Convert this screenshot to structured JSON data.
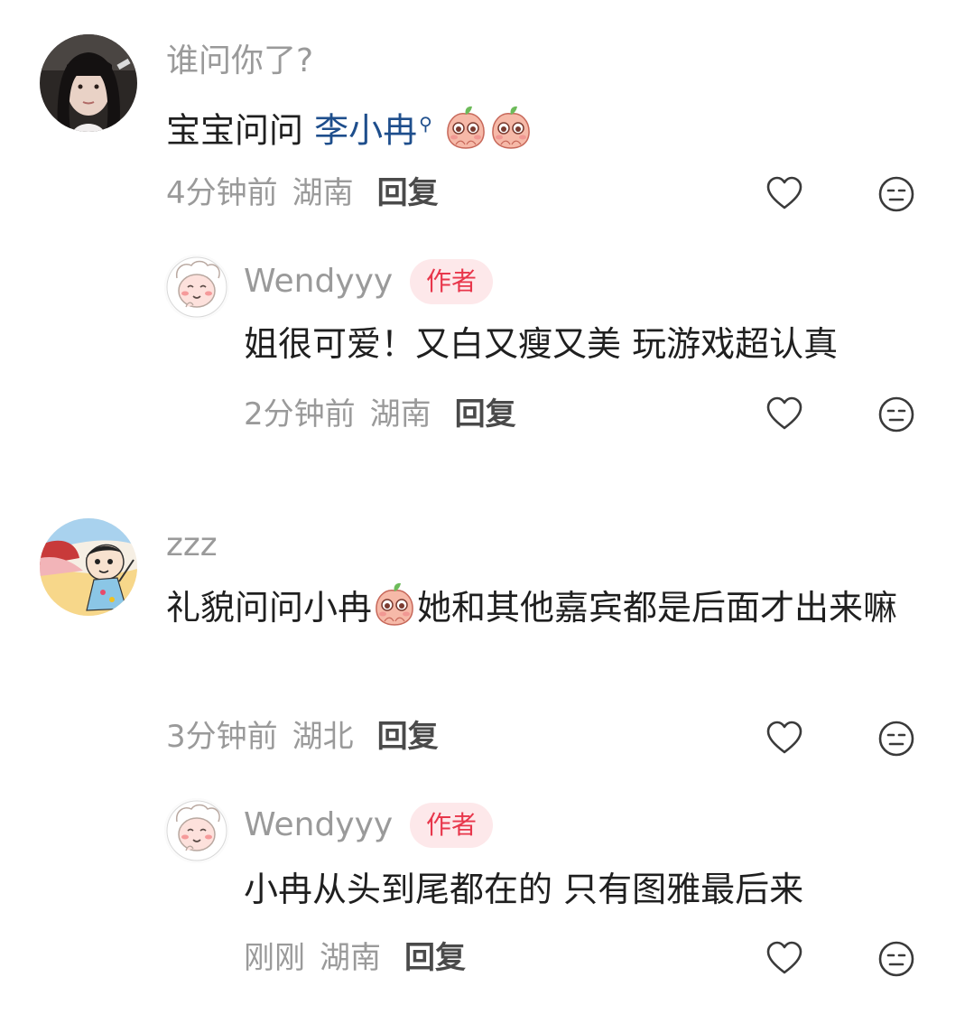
{
  "comments": [
    {
      "username": "谁问你了?",
      "content_prefix": "宝宝问问 ",
      "mention": "李小冉",
      "content_suffix": "",
      "time": "4分钟前",
      "location": "湖南",
      "reply_label": "回复",
      "avatar_icon": "girl-photo-avatar",
      "emoji_icon": "peach-emoji"
    },
    {
      "username": "Wendyyy",
      "badge": "作者",
      "content": "姐很可爱！又白又瘦又美 玩游戏超认真",
      "time": "2分钟前",
      "location": "湖南",
      "reply_label": "回复",
      "avatar_icon": "cartoon-sheep-avatar"
    },
    {
      "username": "zzz",
      "content_part1": "礼貌问问小冉",
      "content_part2": "她和其他嘉宾都是后面才出来嘛",
      "time": "3分钟前",
      "location": "湖北",
      "reply_label": "回复",
      "avatar_icon": "cartoon-boy-avatar",
      "emoji_icon": "peach-emoji"
    },
    {
      "username": "Wendyyy",
      "badge": "作者",
      "content": "小冉从头到尾都在的 只有图雅最后来",
      "time": "刚刚",
      "location": "湖南",
      "reply_label": "回复",
      "avatar_icon": "cartoon-sheep-avatar"
    }
  ],
  "icons": {
    "like": "heart-outline-icon",
    "dislike": "meh-face-icon"
  },
  "colors": {
    "mention": "#1e4e8c",
    "badge_text": "#e8364b",
    "badge_bg": "#fde8ea",
    "meta": "#9a9a9a"
  }
}
